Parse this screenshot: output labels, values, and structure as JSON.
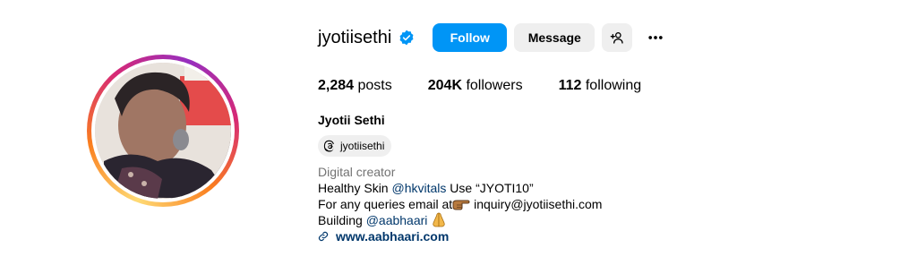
{
  "profile": {
    "username": "jyotiisethi",
    "full_name": "Jyotii Sethi",
    "verified": true
  },
  "buttons": {
    "follow": "Follow",
    "message": "Message"
  },
  "stats": {
    "posts_count": "2,284",
    "posts_label": "posts",
    "followers_count": "204K",
    "followers_label": "followers",
    "following_count": "112",
    "following_label": "following"
  },
  "threads": {
    "handle": "jyotiisethi"
  },
  "bio": {
    "category": "Digital creator",
    "line1_prefix": "Healthy Skin ",
    "line1_mention": "@hkvitals",
    "line1_suffix": " Use “JYOTI10”",
    "line2_prefix": "For any queries email at",
    "line2_suffix": " inquiry@jyotiisethi.com",
    "line3_prefix": "Building ",
    "line3_mention": "@aabhaari",
    "website": "www.aabhaari.com"
  },
  "colors": {
    "primary_button": "#0095f6",
    "secondary_button": "#efefef",
    "link": "#00376b",
    "muted_text": "#737373",
    "verified_badge": "#0095f6"
  },
  "icons": {
    "verified": "verified-badge-icon",
    "add_user": "add-user-icon",
    "more": "more-horizontal-icon",
    "threads": "threads-icon",
    "link": "link-icon",
    "pointing": "pointing-hand-emoji",
    "pray": "folded-hands-emoji"
  }
}
